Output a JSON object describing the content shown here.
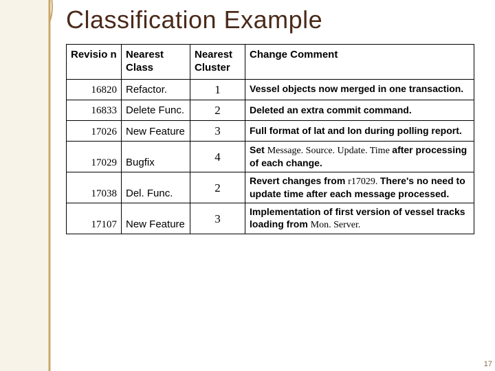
{
  "title": "Classification Example",
  "headers": {
    "revision": "Revisio\nn",
    "class": "Nearest Class",
    "cluster": "Nearest Cluster",
    "comment": "Change Comment"
  },
  "rows": [
    {
      "rev": "16820",
      "cls": "Refactor.",
      "cluster": "1",
      "comment": "Vessel objects now merged in one transaction."
    },
    {
      "rev": "16833",
      "cls": "Delete Func.",
      "cluster": "2",
      "comment": "Deleted an extra commit command."
    },
    {
      "rev": "17026",
      "cls": "New Feature",
      "cluster": "3",
      "comment": "Full format of lat and lon during polling report."
    },
    {
      "rev": "17029",
      "cls": "Bugfix",
      "cluster": "4",
      "comment_html": "<span class='mixed1'>Set </span><span class='mixed2'>Message. Source. Update. Time </span><span class='mixed1'>after processing of each change.</span>"
    },
    {
      "rev": "17038",
      "cls": "Del. Func.",
      "cluster": "2",
      "comment_html": "<span class='mixed1'>Revert changes from </span><span class='mixed2'>r17029. </span><span class='mixed1'>There's no need to update time after each message processed.</span>"
    },
    {
      "rev": "17107",
      "cls": "New Feature",
      "cluster": "3",
      "comment_html": "<span class='mixed1'>Implementation of first version of vessel tracks loading from </span><span class='mixed2'>Mon. Server.</span>"
    }
  ],
  "page_number": "17"
}
